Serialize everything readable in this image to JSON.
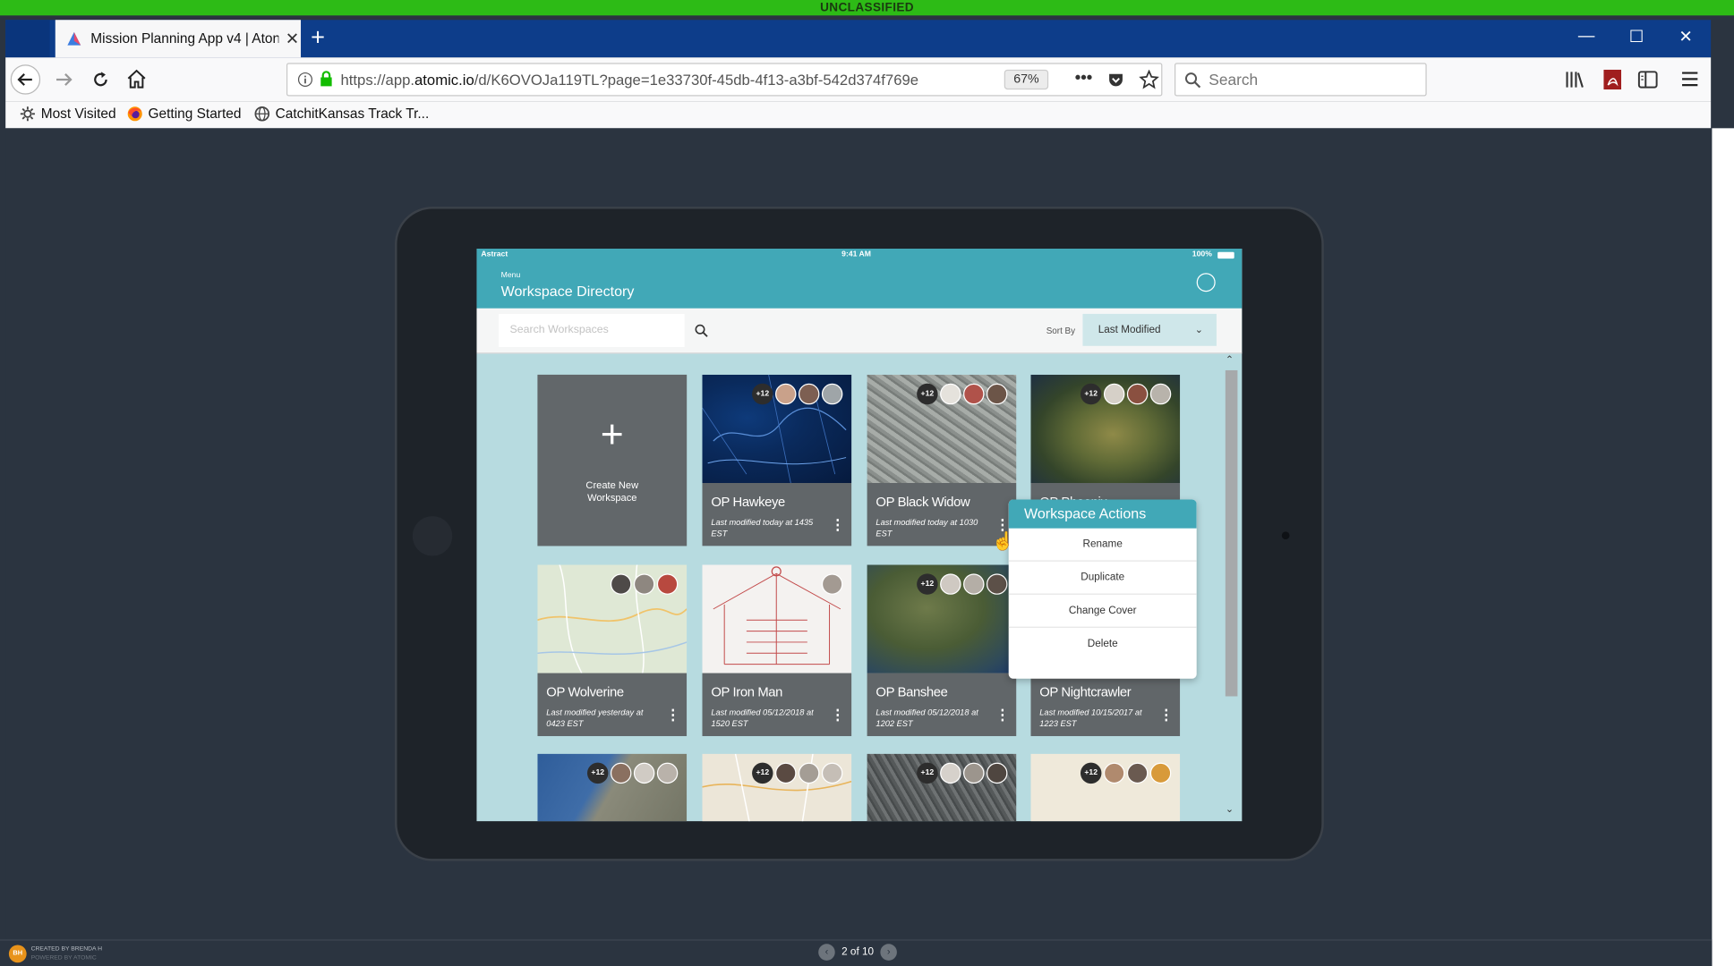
{
  "classification_banner": "UNCLASSIFIED",
  "browser": {
    "tab_title": "Mission Planning App v4 | Aton",
    "url_prefix": "https://app.",
    "url_host": "atomic.io",
    "url_path": "/d/K6OVOJa119TL?page=1e33730f-45db-4f13-a3bf-542d374f769e",
    "zoom": "67%",
    "search_placeholder": "Search",
    "bookmarks": [
      "Most Visited",
      "Getting Started",
      "CatchitKansas Track Tr..."
    ]
  },
  "app": {
    "carrier": "Astract",
    "time": "9:41 AM",
    "battery": "100%",
    "menu_label": "Menu",
    "title": "Workspace Directory",
    "search_placeholder": "Search Workspaces",
    "sort_label": "Sort By",
    "sort_value": "Last Modified",
    "create_label": "Create New Workspace",
    "more_badge": "+12",
    "workspaces": [
      {
        "name": "OP Hawkeye",
        "date": "Last modified today at 1435 EST",
        "more": "+12"
      },
      {
        "name": "OP Black Widow",
        "date": "Last modified today at 1030 EST",
        "more": "+12"
      },
      {
        "name": "OP Phoenix",
        "date": "",
        "more": "+12"
      },
      {
        "name": "OP Wolverine",
        "date": "Last modified yesterday at 0423 EST",
        "more": ""
      },
      {
        "name": "OP Iron Man",
        "date": "Last modified 05/12/2018 at 1520 EST",
        "more": ""
      },
      {
        "name": "OP Banshee",
        "date": "Last modified 05/12/2018 at 1202 EST",
        "more": "+12"
      },
      {
        "name": "OP Nightcrawler",
        "date": "Last modified 10/15/2017 at 1223 EST",
        "more": ""
      }
    ],
    "actions_menu": {
      "title": "Workspace Actions",
      "items": [
        "Rename",
        "Duplicate",
        "Change Cover",
        "Delete"
      ]
    }
  },
  "footer": {
    "badge": "BH",
    "created_by": "CREATED BY BRENDA H",
    "powered_by": "POWERED BY ATOMIC",
    "page_indicator": "2 of 10"
  },
  "colors": {
    "classification": "#2dbb16",
    "accent": "#41a8b7",
    "app_background": "#b7dbe0",
    "card_footer": "#616669"
  }
}
